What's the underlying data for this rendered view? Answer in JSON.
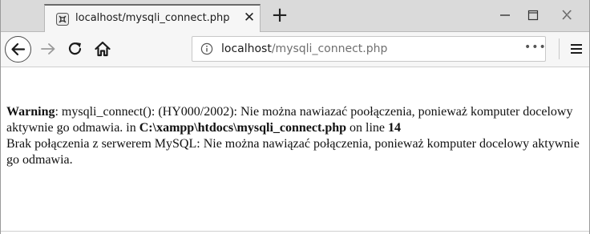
{
  "tab": {
    "title": "localhost/mysqli_connect.php",
    "close_glyph": "✕",
    "new_tab_glyph": "+"
  },
  "address": {
    "host": "localhost",
    "path": "/mysqli_connect.php",
    "more_glyph": "•••"
  },
  "page": {
    "warning_label": "Warning",
    "warning_text": ": mysqli_connect(): (HY000/2002): Nie można nawiazać poołączenia, ponieważ komputer docelowy aktywnie go odmawia. in ",
    "file_path": "C:\\xampp\\htdocs\\mysqli_connect.php",
    "on_line_text": " on line ",
    "line_number": "14",
    "message": "Brak połączenia z serwerem MySQL: Nie można nawiązać połączenia, ponieważ komputer docelowy aktywnie go odmawia."
  },
  "icons": {
    "favicon": "xampp-favicon-icon",
    "back": "back-arrow-icon",
    "forward": "forward-arrow-icon",
    "reload": "reload-icon",
    "home": "home-icon",
    "info": "info-icon",
    "menu": "hamburger-menu-icon",
    "minimize": "minimize-icon",
    "maximize": "maximize-icon",
    "close": "close-window-icon"
  }
}
